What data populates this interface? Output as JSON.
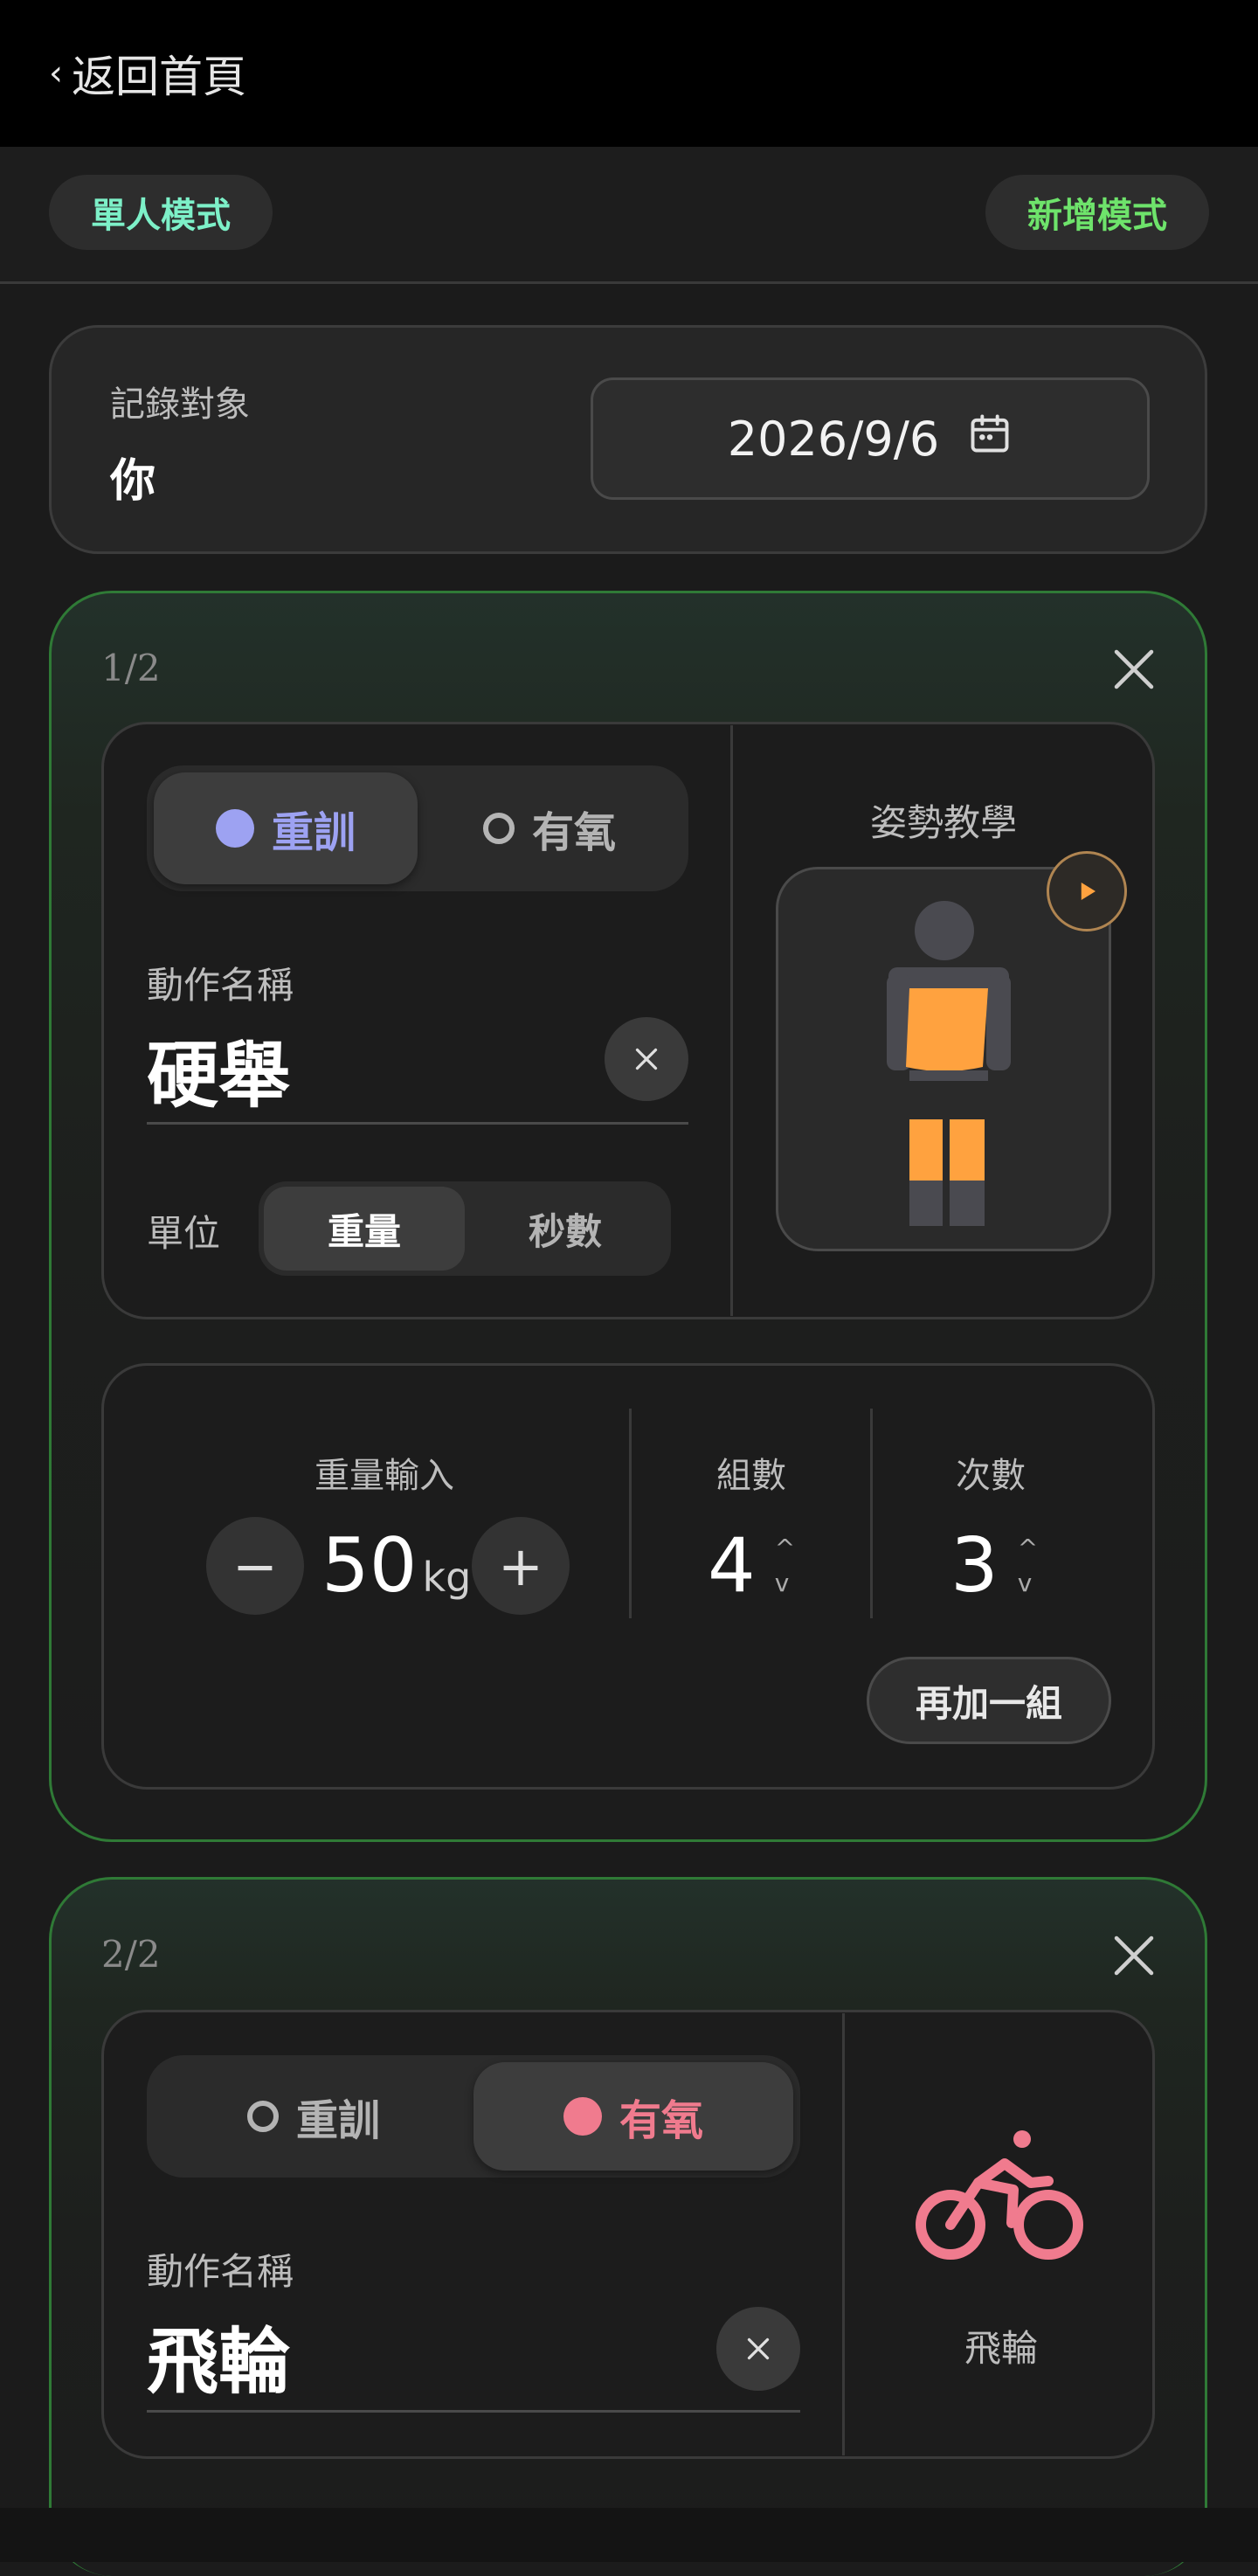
{
  "header": {
    "back_label": "返回首頁"
  },
  "modes": {
    "single_label": "單人模式",
    "add_label": "新增模式"
  },
  "record": {
    "target_label": "記錄對象",
    "target_value": "你",
    "date": "2026/9/6"
  },
  "exercises": [
    {
      "index": "1/2",
      "type_options": {
        "strength": "重訓",
        "cardio": "有氧"
      },
      "selected_type": "strength",
      "name_label": "動作名稱",
      "name_value": "硬舉",
      "unit_label": "單位",
      "unit_options": {
        "weight": "重量",
        "seconds": "秒數"
      },
      "selected_unit": "weight",
      "tutorial_label": "姿勢教學",
      "weight_label": "重量輸入",
      "weight_value": "50",
      "weight_unit": "kg",
      "sets_label": "組數",
      "sets_value": "4",
      "reps_label": "次數",
      "reps_value": "3",
      "add_set_label": "再加一組"
    },
    {
      "index": "2/2",
      "type_options": {
        "strength": "重訓",
        "cardio": "有氧"
      },
      "selected_type": "cardio",
      "name_label": "動作名稱",
      "name_value": "飛輪",
      "preview_label": "飛輪"
    }
  ],
  "colors": {
    "strength_accent": "#9da2f2",
    "cardio_accent": "#f07b8e",
    "muscle_highlight": "#ffa23f",
    "mode_single": "#7df0c8",
    "mode_add": "#6ee36b",
    "card_border": "#2f7a36"
  },
  "icons": {
    "calendar": "calendar-icon",
    "close": "close-icon",
    "play": "play-icon",
    "bike": "bicycle-icon"
  }
}
